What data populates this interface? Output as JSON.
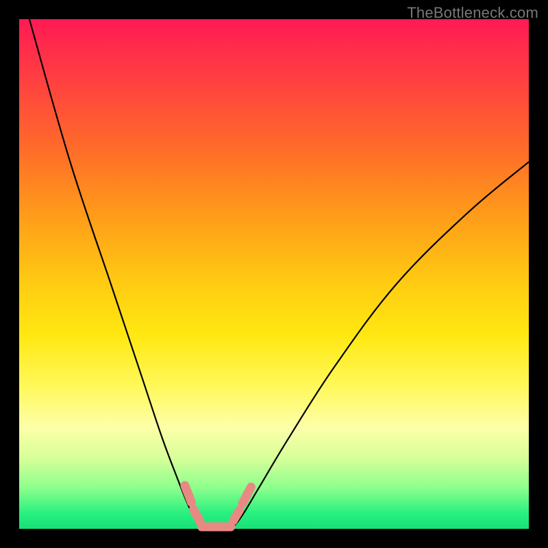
{
  "watermark": "TheBottleneck.com",
  "colors": {
    "frame": "#000000",
    "curve": "#000000",
    "highlight": "#e88a84"
  },
  "chart_data": {
    "type": "line",
    "title": "",
    "xlabel": "",
    "ylabel": "",
    "xlim": [
      0,
      100
    ],
    "ylim": [
      0,
      100
    ],
    "grid": false,
    "series": [
      {
        "name": "bottleneck-curve",
        "x": [
          2,
          10,
          18,
          24,
          28,
          31,
          33,
          34.5,
          36,
          38,
          40,
          42,
          44,
          47,
          53,
          62,
          74,
          88,
          100
        ],
        "y": [
          100,
          72,
          48,
          30,
          18,
          10,
          5,
          2,
          0,
          0,
          0,
          0.5,
          3,
          8,
          18,
          32,
          48,
          62,
          72
        ]
      }
    ],
    "highlight_segments": [
      {
        "name": "left-upper",
        "x": [
          32.5,
          33.8
        ],
        "y": [
          8.5,
          5.2
        ]
      },
      {
        "name": "left-lower",
        "x": [
          34.2,
          35.5
        ],
        "y": [
          3.8,
          1.4
        ]
      },
      {
        "name": "floor",
        "x": [
          35.8,
          41.5
        ],
        "y": [
          0.4,
          0.4
        ]
      },
      {
        "name": "right-lower",
        "x": [
          42.0,
          43.2
        ],
        "y": [
          1.6,
          3.6
        ]
      },
      {
        "name": "right-upper",
        "x": [
          43.8,
          45.5
        ],
        "y": [
          5.0,
          8.2
        ]
      }
    ]
  }
}
